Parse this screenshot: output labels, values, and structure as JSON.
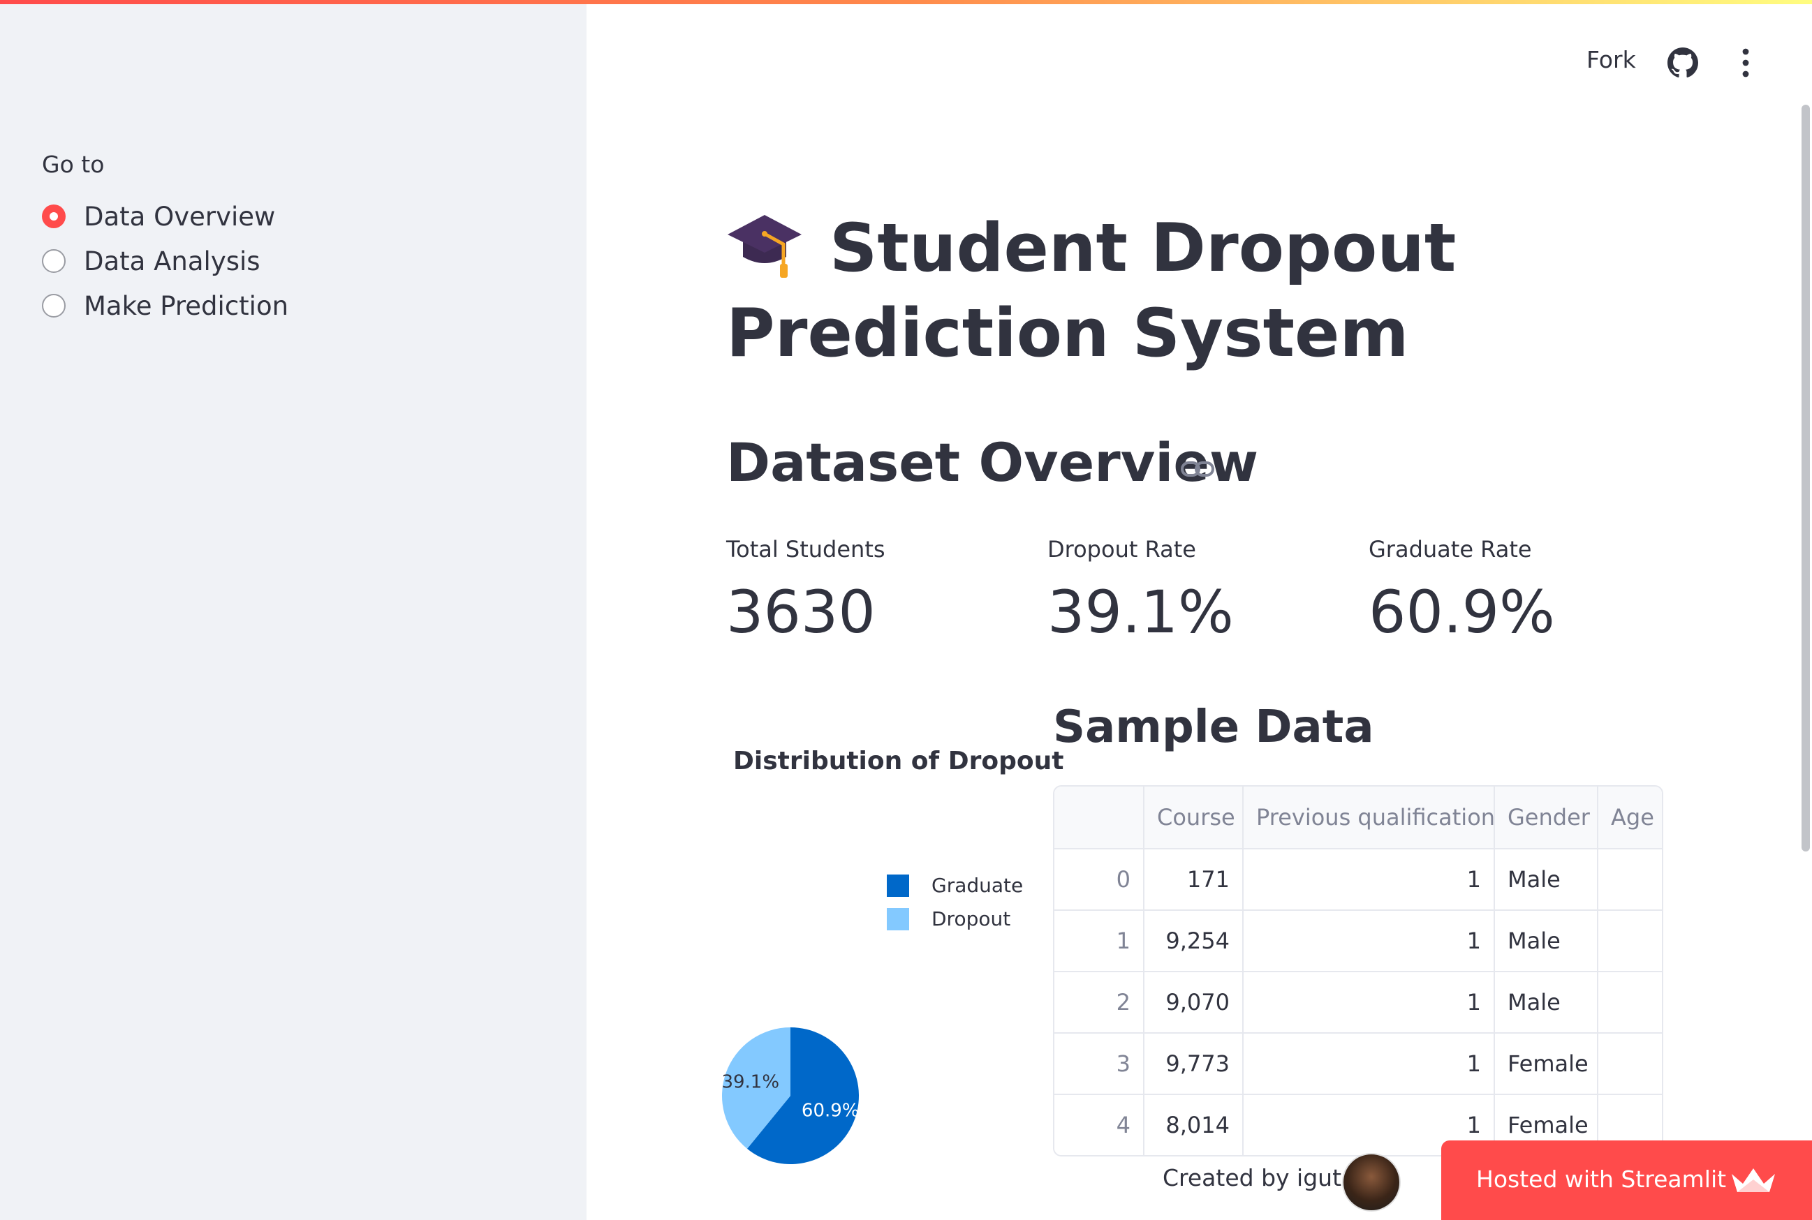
{
  "sidebar": {
    "goto_label": "Go to",
    "options": [
      {
        "label": "Data Overview",
        "selected": true
      },
      {
        "label": "Data Analysis",
        "selected": false
      },
      {
        "label": "Make Prediction",
        "selected": false
      }
    ]
  },
  "header": {
    "fork_label": "Fork",
    "github_icon": "github-icon",
    "menu_icon": "more-vertical-icon"
  },
  "main": {
    "title_icon": "graduation-cap-icon",
    "title": "Student Dropout Prediction System",
    "dataset_overview": "Dataset Overview",
    "link_icon": "link-icon",
    "metrics": [
      {
        "label": "Total Students",
        "value": "3630"
      },
      {
        "label": "Dropout Rate",
        "value": "39.1%"
      },
      {
        "label": "Graduate Rate",
        "value": "60.9%"
      }
    ],
    "sample_title": "Sample Data",
    "table": {
      "columns": [
        "",
        "Course",
        "Previous qualification",
        "Gender",
        "Age a"
      ],
      "rows": [
        [
          "0",
          "171",
          "1",
          "Male"
        ],
        [
          "1",
          "9,254",
          "1",
          "Male"
        ],
        [
          "2",
          "9,070",
          "1",
          "Male"
        ],
        [
          "3",
          "9,773",
          "1",
          "Female"
        ],
        [
          "4",
          "8,014",
          "1",
          "Female"
        ]
      ]
    }
  },
  "chart_data": {
    "type": "pie",
    "title": "Distribution of Dropout",
    "categories": [
      "Graduate",
      "Dropout"
    ],
    "values": [
      60.9,
      39.1
    ],
    "labels": [
      "60.9%",
      "39.1%"
    ],
    "colors": [
      "#0068c9",
      "#83c9ff"
    ],
    "legend_position": "top-right"
  },
  "footer": {
    "created_by": "Created by iguta",
    "hosted_label": "Hosted with Streamlit",
    "brand_color": "#ff4b4b"
  }
}
